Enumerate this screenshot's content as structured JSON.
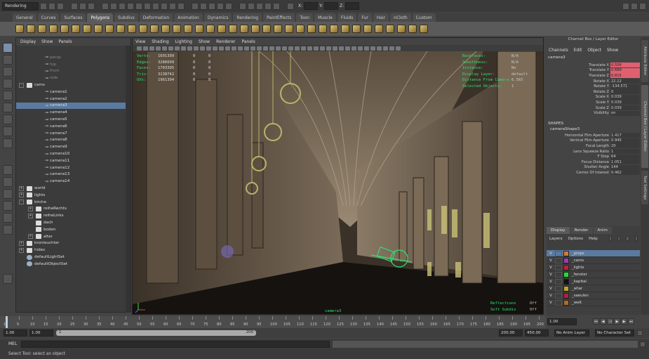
{
  "status": {
    "mode": "Rendering",
    "x_label": "X:",
    "y_label": "Y:",
    "z_label": "Z:"
  },
  "shelf_tabs": [
    "General",
    "Curves",
    "Surfaces",
    "Polygons",
    "Subdivs",
    "Deformation",
    "Animation",
    "Dynamics",
    "Rendering",
    "PaintEffects",
    "Toon",
    "Muscle",
    "Fluids",
    "Fur",
    "Hair",
    "nCloth",
    "Custom"
  ],
  "active_shelf_tab": "Polygons",
  "outliner": {
    "menu": [
      "Display",
      "Show",
      "Panels"
    ],
    "items": [
      {
        "label": "persp",
        "indent": 2,
        "icon": "cam",
        "dim": true
      },
      {
        "label": "top",
        "indent": 2,
        "icon": "cam",
        "dim": true
      },
      {
        "label": "front",
        "indent": 2,
        "icon": "cam",
        "dim": true
      },
      {
        "label": "side",
        "indent": 2,
        "icon": "cam",
        "dim": true
      },
      {
        "label": "cams",
        "indent": 0,
        "icon": "group",
        "expand": "-"
      },
      {
        "label": "camera1",
        "indent": 2,
        "icon": "cam"
      },
      {
        "label": "camera2",
        "indent": 2,
        "icon": "cam"
      },
      {
        "label": "camera3",
        "indent": 2,
        "icon": "cam",
        "selected": true
      },
      {
        "label": "camera4",
        "indent": 2,
        "icon": "cam"
      },
      {
        "label": "camera5",
        "indent": 2,
        "icon": "cam"
      },
      {
        "label": "camera6",
        "indent": 2,
        "icon": "cam"
      },
      {
        "label": "camera7",
        "indent": 2,
        "icon": "cam"
      },
      {
        "label": "camera8",
        "indent": 2,
        "icon": "cam"
      },
      {
        "label": "camera9",
        "indent": 2,
        "icon": "cam"
      },
      {
        "label": "camera10",
        "indent": 2,
        "icon": "cam"
      },
      {
        "label": "camera11",
        "indent": 2,
        "icon": "cam"
      },
      {
        "label": "camera12",
        "indent": 2,
        "icon": "cam"
      },
      {
        "label": "camera13",
        "indent": 2,
        "icon": "cam"
      },
      {
        "label": "camera14",
        "indent": 2,
        "icon": "cam"
      },
      {
        "label": "world",
        "indent": 0,
        "icon": "group",
        "expand": "+"
      },
      {
        "label": "lights",
        "indent": 0,
        "icon": "group",
        "expand": "+"
      },
      {
        "label": "kirche",
        "indent": 0,
        "icon": "group",
        "expand": "-"
      },
      {
        "label": "reiheRechts",
        "indent": 1,
        "icon": "group",
        "expand": "+"
      },
      {
        "label": "reiheLinks",
        "indent": 1,
        "icon": "group",
        "expand": "+"
      },
      {
        "label": "dach",
        "indent": 1,
        "icon": "group"
      },
      {
        "label": "boden",
        "indent": 1,
        "icon": "group"
      },
      {
        "label": "altar",
        "indent": 1,
        "icon": "group",
        "expand": "+"
      },
      {
        "label": "kronleuchter",
        "indent": 0,
        "icon": "group",
        "expand": "+"
      },
      {
        "label": "hides",
        "indent": 0,
        "icon": "group",
        "expand": "+"
      },
      {
        "label": "defaultLightSet",
        "indent": 0,
        "icon": "set"
      },
      {
        "label": "defaultObjectSet",
        "indent": 0,
        "icon": "set"
      }
    ]
  },
  "viewport": {
    "menu": [
      "View",
      "Shading",
      "Lighting",
      "Show",
      "Renderer",
      "Panels"
    ],
    "hud_left": [
      {
        "label": "Verts:",
        "a": "1601399",
        "b": "0",
        "c": "0"
      },
      {
        "label": "Edges:",
        "a": "3286699",
        "b": "0",
        "c": "0"
      },
      {
        "label": "Faces:",
        "a": "1703395",
        "b": "0",
        "c": "0"
      },
      {
        "label": "Tris:",
        "a": "3138742",
        "b": "0",
        "c": "0"
      },
      {
        "label": "UVs:",
        "a": "1961394",
        "b": "0",
        "c": "0"
      }
    ],
    "hud_right": [
      {
        "label": "Backfaces:",
        "v": "N/A"
      },
      {
        "label": "Smoothness:",
        "v": "N/A"
      },
      {
        "label": "Instance:",
        "v": "No"
      },
      {
        "label": "Display Layer:",
        "v": "default"
      },
      {
        "label": "Distance From Camera:",
        "v": "6.565"
      },
      {
        "label": "Selected Objects:",
        "v": "1"
      }
    ],
    "camera_label": "camera3",
    "bottom_right": [
      {
        "label": "Reflections",
        "v": "Off"
      },
      {
        "label": "Soft Subdiv",
        "v": "Off"
      }
    ]
  },
  "channelbox": {
    "title": "Channel Box / Layer Editor",
    "menu": [
      "Channels",
      "Edit",
      "Object",
      "Show"
    ],
    "node": "camera3",
    "attrs": [
      {
        "label": "Translate X",
        "v": "0.556",
        "red": true
      },
      {
        "label": "Translate Y",
        "v": "0.689",
        "red": true
      },
      {
        "label": "Translate Z",
        "v": "0.815",
        "red": true
      },
      {
        "label": "Rotate X",
        "v": "22.12"
      },
      {
        "label": "Rotate Y",
        "v": "-134.571"
      },
      {
        "label": "Rotate Z",
        "v": "0"
      },
      {
        "label": "Scale X",
        "v": "0.039"
      },
      {
        "label": "Scale Y",
        "v": "0.039"
      },
      {
        "label": "Scale Z",
        "v": "0.039"
      },
      {
        "label": "Visibility",
        "v": "on"
      }
    ],
    "shapes_header": "SHAPES",
    "shape_node": "cameraShape3",
    "shape_attrs": [
      {
        "label": "Horizontal Film Aperture",
        "v": "1.417"
      },
      {
        "label": "Vertical Film Aperture",
        "v": "0.945"
      },
      {
        "label": "Focal Length",
        "v": "20"
      },
      {
        "label": "Lens Squeeze Ratio",
        "v": "1"
      },
      {
        "label": "F Stop",
        "v": "64"
      },
      {
        "label": "Focus Distance",
        "v": "1.051"
      },
      {
        "label": "Shutter Angle",
        "v": "144"
      },
      {
        "label": "Center Of Interest",
        "v": "0.462"
      }
    ]
  },
  "layers": {
    "tabs": [
      "Display",
      "Render",
      "Anim"
    ],
    "menu": [
      "Layers",
      "Options",
      "Help"
    ],
    "items": [
      {
        "name": "_props",
        "color": "#d07a30",
        "sel": true
      },
      {
        "name": "_cams",
        "color": "#9b3fb0"
      },
      {
        "name": "_lights",
        "color": "#c0203a"
      },
      {
        "name": "_fenster",
        "color": "#20e030"
      },
      {
        "name": "_kapital",
        "color": "#101010"
      },
      {
        "name": "_altar",
        "color": "#b5a830"
      },
      {
        "name": "_saeulen",
        "color": "#b02040"
      },
      {
        "name": "_welt",
        "color": "#b06a2a"
      }
    ],
    "v": "V"
  },
  "side_tabs": [
    "Attribute Editor",
    "Channel Box / Layer Editor",
    "Tool Settings"
  ],
  "timeline": {
    "ticks": [
      "1",
      "5",
      "10",
      "15",
      "20",
      "25",
      "30",
      "35",
      "40",
      "45",
      "50",
      "55",
      "60",
      "65",
      "70",
      "75",
      "80",
      "85",
      "90",
      "95",
      "100",
      "105",
      "110",
      "115",
      "120",
      "125",
      "130",
      "135",
      "140",
      "145",
      "150",
      "155",
      "160",
      "165",
      "170",
      "175",
      "180",
      "185",
      "190",
      "195",
      "200"
    ],
    "current": "1.00"
  },
  "range": {
    "start": "1.00",
    "start2": "1.00",
    "slider_start": "1",
    "slider_end": "200",
    "end1": "200.00",
    "end2": "450.00",
    "anim_layer": "No Anim Layer",
    "char_set": "No Character Set"
  },
  "command": {
    "label": "MEL"
  },
  "help": "Select Tool: select an object"
}
